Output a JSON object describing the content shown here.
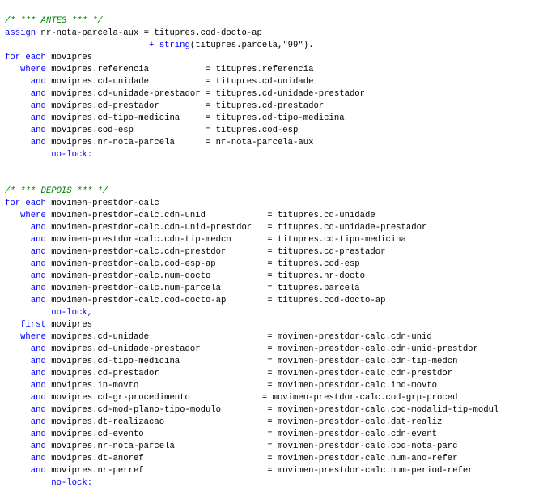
{
  "editor": {
    "colors": {
      "background": "#ffffff",
      "keyword": "#0000ff",
      "comment": "#008000",
      "text": "#000000"
    },
    "lines": [
      [
        {
          "t": "c",
          "v": "/* *** ANTES *** */"
        }
      ],
      [
        {
          "t": "k",
          "v": "assign"
        },
        {
          "t": "p",
          "v": " nr-nota-parcela-aux = titupres.cod-docto-ap"
        }
      ],
      [
        {
          "t": "p",
          "v": "                            "
        },
        {
          "t": "k",
          "v": "+"
        },
        {
          "t": "p",
          "v": " "
        },
        {
          "t": "k",
          "v": "string"
        },
        {
          "t": "p",
          "v": "(titupres.parcela,\"99\")."
        }
      ],
      [
        {
          "t": "k",
          "v": "for each"
        },
        {
          "t": "p",
          "v": " movipres"
        }
      ],
      [
        {
          "t": "p",
          "v": "   "
        },
        {
          "t": "k",
          "v": "where"
        },
        {
          "t": "p",
          "v": " movipres.referencia           = titupres.referencia"
        }
      ],
      [
        {
          "t": "p",
          "v": "     "
        },
        {
          "t": "k",
          "v": "and"
        },
        {
          "t": "p",
          "v": " movipres.cd-unidade           = titupres.cd-unidade"
        }
      ],
      [
        {
          "t": "p",
          "v": "     "
        },
        {
          "t": "k",
          "v": "and"
        },
        {
          "t": "p",
          "v": " movipres.cd-unidade-prestador = titupres.cd-unidade-prestador"
        }
      ],
      [
        {
          "t": "p",
          "v": "     "
        },
        {
          "t": "k",
          "v": "and"
        },
        {
          "t": "p",
          "v": " movipres.cd-prestador         = titupres.cd-prestador"
        }
      ],
      [
        {
          "t": "p",
          "v": "     "
        },
        {
          "t": "k",
          "v": "and"
        },
        {
          "t": "p",
          "v": " movipres.cd-tipo-medicina     = titupres.cd-tipo-medicina"
        }
      ],
      [
        {
          "t": "p",
          "v": "     "
        },
        {
          "t": "k",
          "v": "and"
        },
        {
          "t": "p",
          "v": " movipres.cod-esp              = titupres.cod-esp"
        }
      ],
      [
        {
          "t": "p",
          "v": "     "
        },
        {
          "t": "k",
          "v": "and"
        },
        {
          "t": "p",
          "v": " movipres.nr-nota-parcela      = nr-nota-parcela-aux"
        }
      ],
      [
        {
          "t": "p",
          "v": "         "
        },
        {
          "t": "k",
          "v": "no-lock:"
        }
      ],
      [],
      [],
      [
        {
          "t": "c",
          "v": "/* *** DEPOIS *** */"
        }
      ],
      [
        {
          "t": "k",
          "v": "for each"
        },
        {
          "t": "p",
          "v": " movimen-prestdor-calc"
        }
      ],
      [
        {
          "t": "p",
          "v": "   "
        },
        {
          "t": "k",
          "v": "where"
        },
        {
          "t": "p",
          "v": " movimen-prestdor-calc.cdn-unid            = titupres.cd-unidade"
        }
      ],
      [
        {
          "t": "p",
          "v": "     "
        },
        {
          "t": "k",
          "v": "and"
        },
        {
          "t": "p",
          "v": " movimen-prestdor-calc.cdn-unid-prestdor   = titupres.cd-unidade-prestador"
        }
      ],
      [
        {
          "t": "p",
          "v": "     "
        },
        {
          "t": "k",
          "v": "and"
        },
        {
          "t": "p",
          "v": " movimen-prestdor-calc.cdn-tip-medcn       = titupres.cd-tipo-medicina"
        }
      ],
      [
        {
          "t": "p",
          "v": "     "
        },
        {
          "t": "k",
          "v": "and"
        },
        {
          "t": "p",
          "v": " movimen-prestdor-calc.cdn-prestdor        = titupres.cd-prestador"
        }
      ],
      [
        {
          "t": "p",
          "v": "     "
        },
        {
          "t": "k",
          "v": "and"
        },
        {
          "t": "p",
          "v": " movimen-prestdor-calc.cod-esp-ap          = titupres.cod-esp"
        }
      ],
      [
        {
          "t": "p",
          "v": "     "
        },
        {
          "t": "k",
          "v": "and"
        },
        {
          "t": "p",
          "v": " movimen-prestdor-calc.num-docto           = titupres.nr-docto"
        }
      ],
      [
        {
          "t": "p",
          "v": "     "
        },
        {
          "t": "k",
          "v": "and"
        },
        {
          "t": "p",
          "v": " movimen-prestdor-calc.num-parcela         = titupres.parcela"
        }
      ],
      [
        {
          "t": "p",
          "v": "     "
        },
        {
          "t": "k",
          "v": "and"
        },
        {
          "t": "p",
          "v": " movimen-prestdor-calc.cod-docto-ap        = titupres.cod-docto-ap"
        }
      ],
      [
        {
          "t": "p",
          "v": "         "
        },
        {
          "t": "k",
          "v": "no-lock,"
        }
      ],
      [
        {
          "t": "p",
          "v": "   "
        },
        {
          "t": "k",
          "v": "first"
        },
        {
          "t": "p",
          "v": " movipres"
        }
      ],
      [
        {
          "t": "p",
          "v": "   "
        },
        {
          "t": "k",
          "v": "where"
        },
        {
          "t": "p",
          "v": " movipres.cd-unidade                       = movimen-prestdor-calc.cdn-unid"
        }
      ],
      [
        {
          "t": "p",
          "v": "     "
        },
        {
          "t": "k",
          "v": "and"
        },
        {
          "t": "p",
          "v": " movipres.cd-unidade-prestador             = movimen-prestdor-calc.cdn-unid-prestdor"
        }
      ],
      [
        {
          "t": "p",
          "v": "     "
        },
        {
          "t": "k",
          "v": "and"
        },
        {
          "t": "p",
          "v": " movipres.cd-tipo-medicina                 = movimen-prestdor-calc.cdn-tip-medcn"
        }
      ],
      [
        {
          "t": "p",
          "v": "     "
        },
        {
          "t": "k",
          "v": "and"
        },
        {
          "t": "p",
          "v": " movipres.cd-prestador                     = movimen-prestdor-calc.cdn-prestdor"
        }
      ],
      [
        {
          "t": "p",
          "v": "     "
        },
        {
          "t": "k",
          "v": "and"
        },
        {
          "t": "p",
          "v": " movipres.in-movto                         = movimen-prestdor-calc.ind-movto"
        }
      ],
      [
        {
          "t": "p",
          "v": "     "
        },
        {
          "t": "k",
          "v": "and"
        },
        {
          "t": "p",
          "v": " movipres.cd-gr-procedimento              = movimen-prestdor-calc.cod-grp-proced"
        }
      ],
      [
        {
          "t": "p",
          "v": "     "
        },
        {
          "t": "k",
          "v": "and"
        },
        {
          "t": "p",
          "v": " movipres.cd-mod-plano-tipo-modulo         = movimen-prestdor-calc.cod-modalid-tip-modul"
        }
      ],
      [
        {
          "t": "p",
          "v": "     "
        },
        {
          "t": "k",
          "v": "and"
        },
        {
          "t": "p",
          "v": " movipres.dt-realizacao                    = movimen-prestdor-calc.dat-realiz"
        }
      ],
      [
        {
          "t": "p",
          "v": "     "
        },
        {
          "t": "k",
          "v": "and"
        },
        {
          "t": "p",
          "v": " movipres.cd-evento                        = movimen-prestdor-calc.cdn-event"
        }
      ],
      [
        {
          "t": "p",
          "v": "     "
        },
        {
          "t": "k",
          "v": "and"
        },
        {
          "t": "p",
          "v": " movipres.nr-nota-parcela                  = movimen-prestdor-calc.cod-nota-parc"
        }
      ],
      [
        {
          "t": "p",
          "v": "     "
        },
        {
          "t": "k",
          "v": "and"
        },
        {
          "t": "p",
          "v": " movipres.dt-anoref                        = movimen-prestdor-calc.num-ano-refer"
        }
      ],
      [
        {
          "t": "p",
          "v": "     "
        },
        {
          "t": "k",
          "v": "and"
        },
        {
          "t": "p",
          "v": " movipres.nr-perref                        = movimen-prestdor-calc.num-period-refer"
        }
      ],
      [
        {
          "t": "p",
          "v": "         "
        },
        {
          "t": "k",
          "v": "no-lock:"
        }
      ]
    ]
  }
}
